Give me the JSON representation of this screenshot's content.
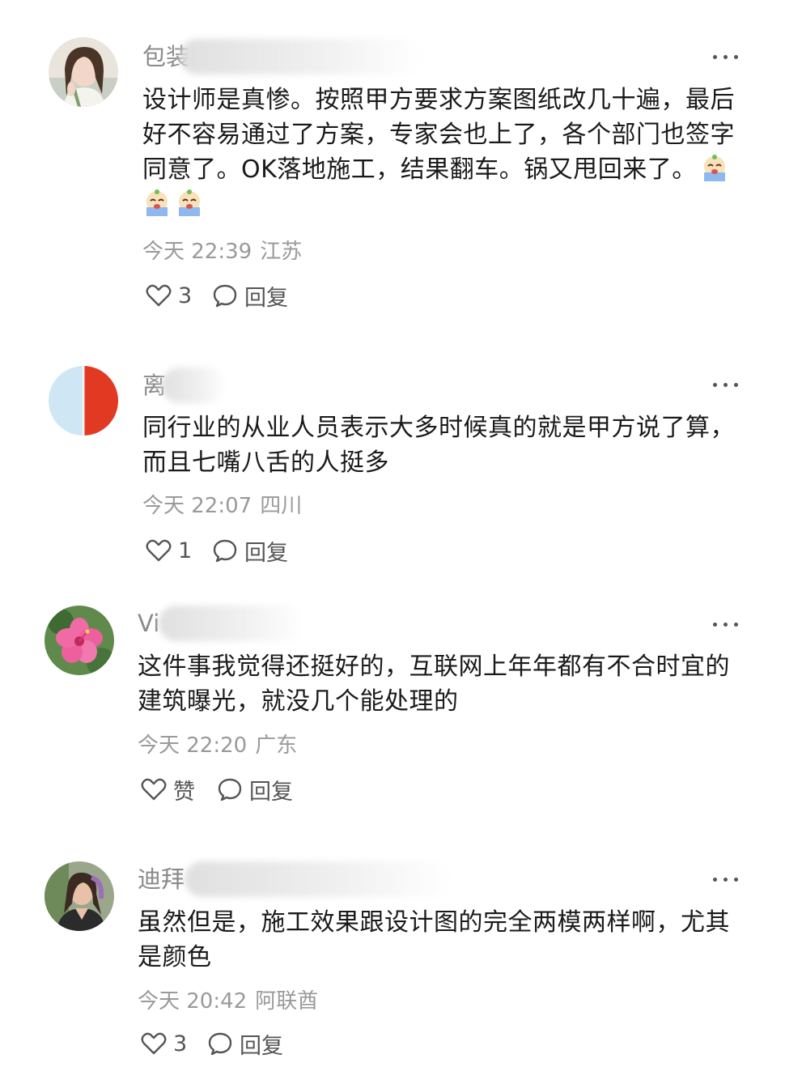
{
  "comments": [
    {
      "username": "包装",
      "text": "设计师是真惨。按照甲方要求方案图纸改几十遍，最后好不容易通过了方案，专家会也上了，各个部门也签字同意了。OK落地施工，结果翻车。锅又甩回来了。",
      "time": "今天 22:39",
      "location": "江苏",
      "likes": "3",
      "reply_label": "回复",
      "emoji_count": 3
    },
    {
      "username": "离",
      "text": "同行业的从业人员表示大多时候真的就是甲方说了算，而且七嘴八舌的人挺多",
      "time": "今天 22:07",
      "location": "四川",
      "likes": "1",
      "reply_label": "回复"
    },
    {
      "username": "Vi",
      "text": "这件事我觉得还挺好的，互联网上年年都有不合时宜的建筑曝光，就没几个能处理的",
      "time": "今天 22:20",
      "location": "广东",
      "likes": "赞",
      "reply_label": "回复"
    },
    {
      "username": "迪拜",
      "text": "虽然但是，施工效果跟设计图的完全两模两样啊，尤其是颜色",
      "time": "今天 20:42",
      "location": "阿联酋",
      "likes": "3",
      "reply_label": "回复"
    }
  ],
  "icons": {
    "like": "heart-outline-icon",
    "reply": "speech-bubble-icon",
    "more": "more-dots-icon",
    "emoji": "crying-face-emoji"
  },
  "colors": {
    "text": "#1a1a1a",
    "meta": "#9a9a9a",
    "username": "#8a8a8a"
  }
}
